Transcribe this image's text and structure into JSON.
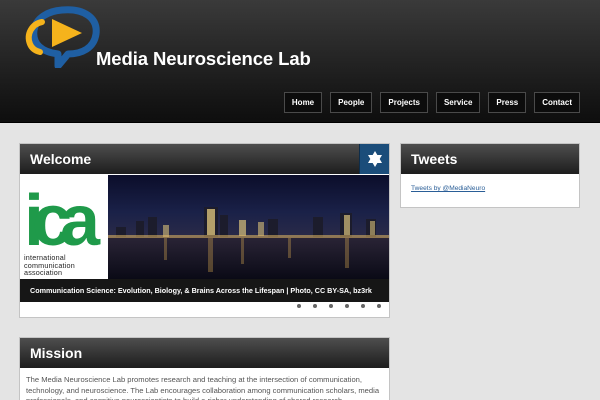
{
  "header": {
    "site_title": "Media Neuroscience Lab",
    "nav": [
      {
        "label": "Home"
      },
      {
        "label": "People"
      },
      {
        "label": "Projects"
      },
      {
        "label": "Service"
      },
      {
        "label": "Press"
      },
      {
        "label": "Contact"
      }
    ]
  },
  "welcome": {
    "title": "Welcome",
    "icon": "star-of-david-icon",
    "slide": {
      "logo_letters": "ica",
      "logo_lines": [
        "international",
        "communication",
        "association"
      ],
      "caption": "Communication Science: Evolution, Biology, & Brains Across the Lifespan | Photo, CC BY-SA, bz3rk"
    }
  },
  "tweets": {
    "title": "Tweets",
    "link": "Tweets by @MediaNeuro"
  },
  "mission": {
    "title": "Mission",
    "text": "The Media Neuroscience Lab promotes research and teaching at the intersection of communication, technology, and neuroscience. The Lab encourages collaboration among communication scholars, media professionals, and cognitive neuroscientists to build a richer understanding of shared research"
  },
  "colors": {
    "accent_blue": "#1b4d7a",
    "logo_yellow": "#f5b31c",
    "logo_blue": "#1f5fa3",
    "link_blue": "#2a5e97"
  }
}
